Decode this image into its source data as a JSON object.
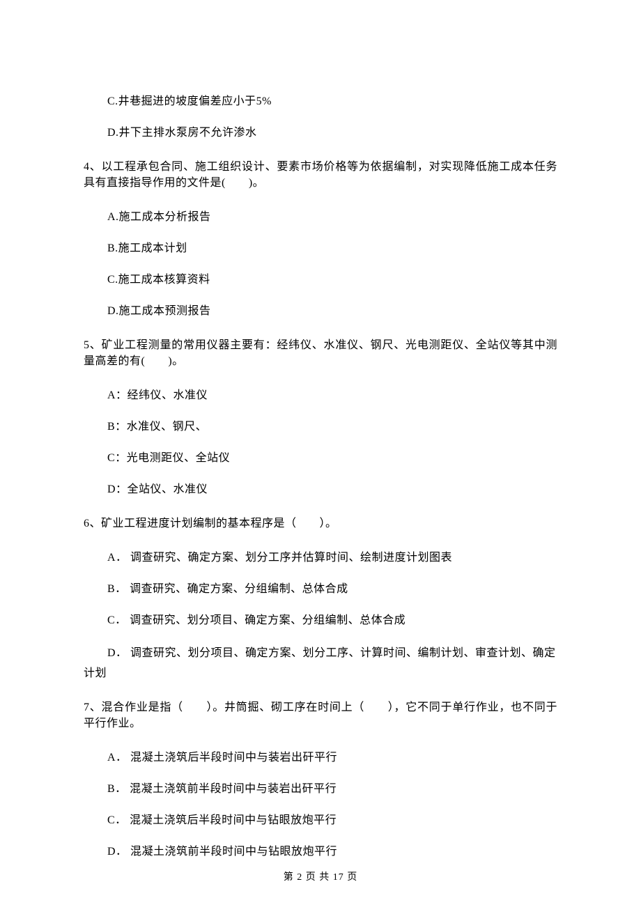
{
  "q3": {
    "c": "C.井巷掘进的坡度偏差应小于5%",
    "d": "D.井下主排水泵房不允许渗水"
  },
  "q4": {
    "stem": "4、以工程承包合同、施工组织设计、要素市场价格等为依据编制，对实现降低施工成本任务具有直接指导作用的文件是(　　)。",
    "a": "A.施工成本分析报告",
    "b": "B.施工成本计划",
    "c": "C.施工成本核算资料",
    "d": "D.施工成本预测报告"
  },
  "q5": {
    "stem": "5、矿业工程测量的常用仪器主要有：经纬仪、水准仪、钢尺、光电测距仪、全站仪等其中测量高差的有(　　)。",
    "a": "A：经纬仪、水准仪",
    "b": "B：水准仪、钢尺、",
    "c": "C：光电测距仪、全站仪",
    "d": "D：全站仪、水准仪"
  },
  "q6": {
    "stem": "6、矿业工程进度计划编制的基本程序是（　　）。",
    "a": "A． 调查研究、确定方案、划分工序并估算时间、绘制进度计划图表",
    "b": "B． 调查研究、确定方案、分组编制、总体合成",
    "c": "C． 调查研究、划分项目、确定方案、分组编制、总体合成",
    "d1": "D． 调查研究、划分项目、确定方案、划分工序、计算时间、编制计划、审查计划、确定",
    "d2": "计划"
  },
  "q7": {
    "stem": "7、混合作业是指（　　）。井筒掘、砌工序在时间上（　　），它不同于单行作业，也不同于平行作业。",
    "a": "A． 混凝土浇筑后半段时间中与装岩出矸平行",
    "b": "B． 混凝土浇筑前半段时间中与装岩出矸平行",
    "c": "C． 混凝土浇筑后半段时间中与钻眼放炮平行",
    "d": "D． 混凝土浇筑前半段时间中与钻眼放炮平行"
  },
  "footer": "第 2 页 共 17 页"
}
